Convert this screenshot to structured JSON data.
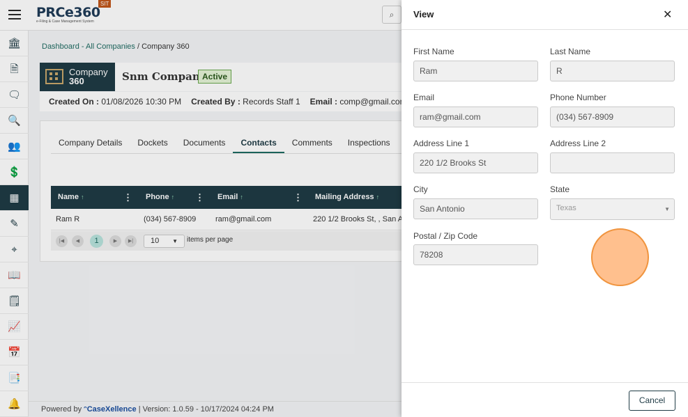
{
  "header": {
    "logo_text": "PRCe360",
    "logo_tagline": "e-Filing & Case Management System",
    "env_badge": "SIT",
    "search_icon": "search-icon"
  },
  "sidebar": {
    "items": [
      {
        "name": "bank-icon",
        "glyph": "🏛"
      },
      {
        "name": "document-icon",
        "glyph": "🗎"
      },
      {
        "name": "chat-icon",
        "glyph": "🗨"
      },
      {
        "name": "document-search-icon",
        "glyph": "🔍"
      },
      {
        "name": "users-icon",
        "glyph": "👥"
      },
      {
        "name": "invoice-icon",
        "glyph": "💲"
      },
      {
        "name": "companies-icon",
        "glyph": "▦",
        "active": true
      },
      {
        "name": "notes-icon",
        "glyph": "✎"
      },
      {
        "name": "scan-icon",
        "glyph": "⌖"
      },
      {
        "name": "book-icon",
        "glyph": "📖"
      },
      {
        "name": "file-icon",
        "glyph": "🗒"
      },
      {
        "name": "chart-icon",
        "glyph": "📈"
      },
      {
        "name": "calendar-icon",
        "glyph": "📅"
      },
      {
        "name": "docs-icon",
        "glyph": "📑"
      },
      {
        "name": "bell-icon",
        "glyph": "🔔"
      }
    ]
  },
  "breadcrumb": {
    "link": "Dashboard - All Companies",
    "separator": " / ",
    "current": "Company 360"
  },
  "company": {
    "tile_line1": "Company",
    "tile_line2": "360",
    "name": "Snm Company",
    "status": "Active",
    "created_on_label": "Created On :",
    "created_on": "01/08/2026 10:30 PM",
    "created_by_label": "Created By :",
    "created_by": "Records Staff 1",
    "email_label": "Email :",
    "email": "comp@gmail.com"
  },
  "tabs": [
    {
      "label": "Company Details",
      "active": false
    },
    {
      "label": "Dockets",
      "active": false
    },
    {
      "label": "Documents",
      "active": false
    },
    {
      "label": "Contacts",
      "active": true
    },
    {
      "label": "Comments",
      "active": false
    },
    {
      "label": "Inspections",
      "active": false
    }
  ],
  "grid": {
    "columns": [
      "Name",
      "Phone",
      "Email",
      "Mailing Address"
    ],
    "rows": [
      [
        "Ram R",
        "(034) 567-8909",
        "ram@gmail.com",
        "220 1/2 Brooks St, , San A"
      ]
    ],
    "pager": {
      "page": "1",
      "page_size": "10",
      "items_per_page_label": "items per page"
    }
  },
  "footer": {
    "powered_by": "Powered by",
    "brand": "CaseXellence",
    "separator": "|",
    "version": "Version: 1.0.59 - 10/17/2024 04:24 PM"
  },
  "drawer": {
    "title": "View",
    "close_icon": "close-icon",
    "fields": {
      "first_name": {
        "label": "First Name",
        "value": "Ram"
      },
      "last_name": {
        "label": "Last Name",
        "value": "R"
      },
      "email": {
        "label": "Email",
        "value": "ram@gmail.com"
      },
      "phone": {
        "label": "Phone Number",
        "value": "(034) 567-8909"
      },
      "address1": {
        "label": "Address Line 1",
        "value": "220 1/2 Brooks St"
      },
      "address2": {
        "label": "Address Line 2",
        "value": ""
      },
      "city": {
        "label": "City",
        "value": "San Antonio"
      },
      "state": {
        "label": "State",
        "value": "Texas"
      },
      "zip": {
        "label": "Postal / Zip Code",
        "value": "78208"
      }
    },
    "cancel_label": "Cancel"
  },
  "colors": {
    "primary": "#1f3b45",
    "accent": "#1e6b62",
    "status_active": "#6aa84f",
    "badge": "#c0561b"
  }
}
